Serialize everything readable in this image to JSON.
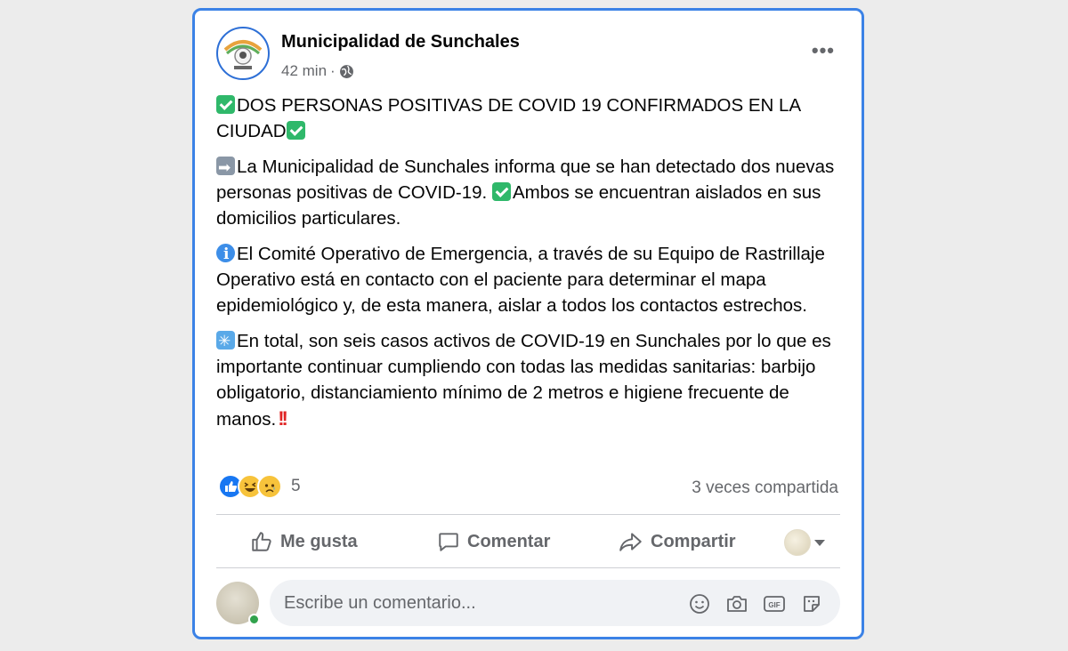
{
  "post": {
    "page_name": "Municipalidad de Sunchales",
    "time": "42 min",
    "separator": "·",
    "paragraphs": {
      "p1_a": "DOS PERSONAS POSITIVAS DE COVID 19 CONFIRMADOS EN LA CIUDAD",
      "p2_a": "La Municipalidad de Sunchales informa que se han detectado dos nuevas personas positivas de COVID-19. ",
      "p2_b": "Ambos se encuentran aislados en sus domicilios particulares.",
      "p3_a": "El Comité Operativo de Emergencia, a través de su Equipo de Rastrillaje Operativo está en contacto con el paciente para determinar el mapa epidemiológico y, de esta manera, aislar a todos los contactos estrechos.",
      "p4_a": "En total, son seis casos activos de COVID-19 en Sunchales por lo que es importante continuar cumpliendo con todas las medidas sanitarias: barbijo obligatorio, distanciamiento mínimo de 2 metros e higiene frecuente de manos.",
      "p4_bang": "!!"
    },
    "reaction_count": "5",
    "shares": "3 veces compartida"
  },
  "actions": {
    "like": "Me gusta",
    "comment": "Comentar",
    "share": "Compartir"
  },
  "comment_box": {
    "placeholder": "Escribe un comentario..."
  },
  "colors": {
    "accent": "#1877f2",
    "frame": "#3b82e6",
    "secondary_text": "#65676b"
  }
}
